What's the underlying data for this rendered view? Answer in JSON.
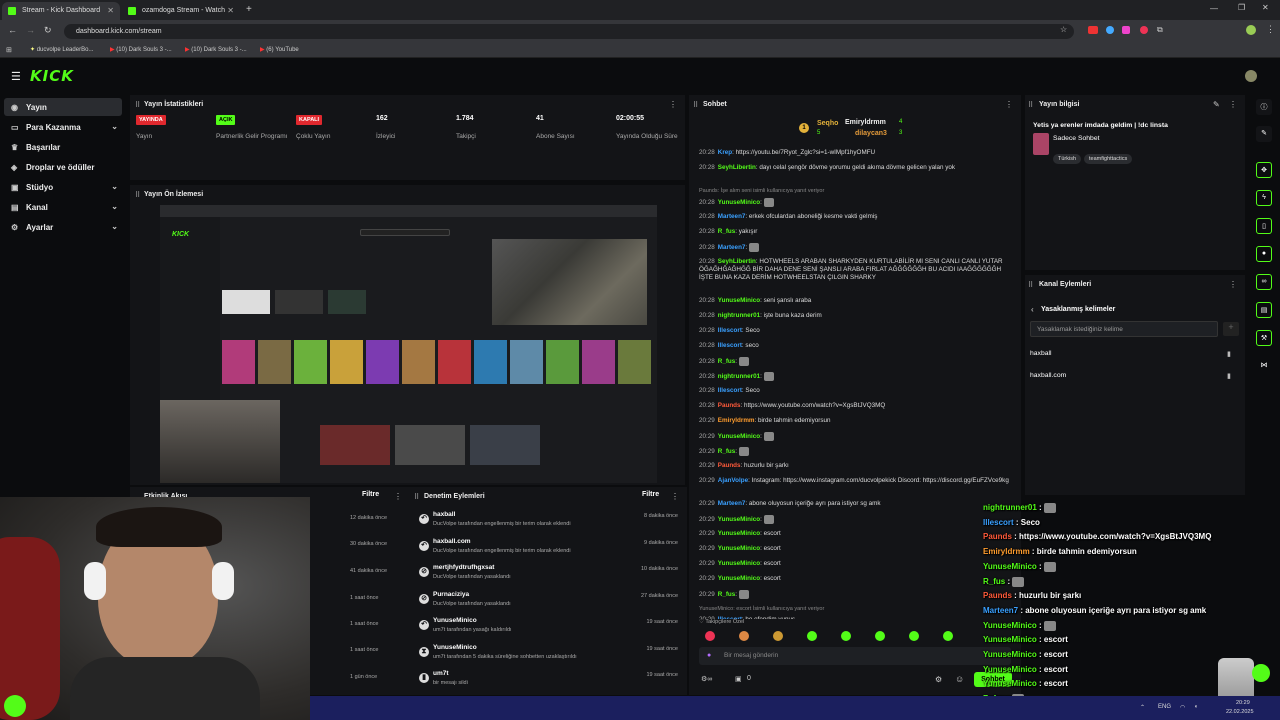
{
  "browser": {
    "tabs": [
      {
        "title": "Stream - Kick Dashboard",
        "active": true
      },
      {
        "title": "ozamdoga Stream - Watch",
        "active": false
      }
    ],
    "url": "dashboard.kick.com/stream",
    "bookmarks": [
      "ducvolpe LeaderBo...",
      "(10) Dark Souls 3 -...",
      "(10) Dark Souls 3 -...",
      "(6) YouTube"
    ]
  },
  "brand": {
    "logo": "KICK",
    "accent": "#53fc18"
  },
  "sidebar": {
    "items": [
      {
        "label": "Yayın",
        "active": true,
        "chevron": false,
        "icon": "broadcast-icon"
      },
      {
        "label": "Para Kazanma",
        "active": false,
        "chevron": true,
        "icon": "money-icon"
      },
      {
        "label": "Başarılar",
        "active": false,
        "chevron": false,
        "icon": "trophy-icon"
      },
      {
        "label": "Droplar ve ödüller",
        "active": false,
        "chevron": false,
        "icon": "gift-icon"
      },
      {
        "label": "Stüdyo",
        "active": false,
        "chevron": true,
        "icon": "studio-icon"
      },
      {
        "label": "Kanal",
        "active": false,
        "chevron": true,
        "icon": "channel-icon"
      },
      {
        "label": "Ayarlar",
        "active": false,
        "chevron": true,
        "icon": "gear-icon"
      }
    ]
  },
  "stats": {
    "title": "Yayın İstatistikleri",
    "items": [
      {
        "value": "YAYINDA",
        "label": "Yayın",
        "badge": "red"
      },
      {
        "value": "AÇIK",
        "label": "Partnerlik Gelir Programı",
        "badge": "green"
      },
      {
        "value": "KAPALI",
        "label": "Çoklu Yayın",
        "badge": "red"
      },
      {
        "value": "162",
        "label": "İzleyici"
      },
      {
        "value": "1.784",
        "label": "Takipçi"
      },
      {
        "value": "41",
        "label": "Abone Sayısı"
      },
      {
        "value": "02:00:55",
        "label": "Yayında Olduğu Süre"
      }
    ]
  },
  "preview": {
    "title": "Yayın Ön İzlemesi"
  },
  "activity": {
    "title": "Etkinlik Akışı",
    "filter": "Filtre",
    "times": [
      "12 dakika önce",
      "30 dakika önce",
      "41 dakika önce",
      "1 saat önce",
      "1 saat önce",
      "1 saat önce",
      "1 gün önce"
    ]
  },
  "moderation": {
    "title": "Denetim Eylemleri",
    "filter": "Filtre",
    "rows": [
      {
        "title": "haxball",
        "sub": "DucVolpe tarafından engellenmiş bir terim olarak eklendi",
        "time": "8 dakika önce",
        "icon": "undo-icon"
      },
      {
        "title": "haxball.com",
        "sub": "DucVolpe tarafından engellenmiş bir terim olarak eklendi",
        "time": "9 dakika önce",
        "icon": "undo-icon"
      },
      {
        "title": "mertjhfydtrufhgxsat",
        "sub": "DucVolpe tarafından yasaklandı",
        "time": "10 dakika önce",
        "icon": "ban-icon"
      },
      {
        "title": "Purnaciziya",
        "sub": "DucVolpe tarafından yasaklandı",
        "time": "27 dakika önce",
        "icon": "ban-icon"
      },
      {
        "title": "YunuseMinico",
        "sub": "um7t tarafından yasağı kaldırıldı",
        "time": "19 saat önce",
        "icon": "undo-icon"
      },
      {
        "title": "YunuseMinico",
        "sub": "um7t tarafından 5 dakika süreliğine sohbetten uzaklaştırıldı",
        "time": "19 saat önce",
        "icon": "hourglass-icon"
      },
      {
        "title": "um7t",
        "sub": "bir mesajı sildi",
        "time": "19 saat önce",
        "icon": "trash-icon"
      }
    ]
  },
  "chat": {
    "title": "Sohbet",
    "leaders": [
      {
        "name": "Seqho",
        "count": "5"
      },
      {
        "name": "Emiryldrmm",
        "count": "4"
      },
      {
        "name": "dilaycan3",
        "count": "3"
      }
    ],
    "messages": [
      {
        "time": "20:28",
        "user": "Krep",
        "color": "#3aa0ff",
        "text": "https://youtu.be/7Ryot_Zglc?si=1-wIMpf1hyOMFU"
      },
      {
        "time": "20:28",
        "user": "SeyhLibertin",
        "color": "#53fc18",
        "text": "dayı celal şengör dövme yorumu geldi akıma dövme gelicen yalan yok"
      },
      {
        "time": "",
        "user": "",
        "color": "#888",
        "text": "Paunds: İşe alım seni isimli kullanıcıya yanıt veriyor",
        "system": true
      },
      {
        "time": "20:28",
        "user": "YunuseMinico",
        "color": "#53fc18",
        "text": ""
      },
      {
        "time": "20:28",
        "user": "Marteen7",
        "color": "#3aa0ff",
        "text": "erkek ofculardan aboneliği kesme vakti gelmiş"
      },
      {
        "time": "20:28",
        "user": "R_fus",
        "color": "#53fc18",
        "text": "yakışır"
      },
      {
        "time": "20:28",
        "user": "Marteen7",
        "color": "#3aa0ff",
        "text": ""
      },
      {
        "time": "20:28",
        "user": "SeyhLibertin",
        "color": "#53fc18",
        "text": "HOTWHEELS ARABAN SHARKYDEN KURTULABİLİR MI SENI CANLI CANLI YUTAR ÖĞAĞHĞAĞHĞĞ BİR DAHA DENE SENİ ŞANSLI ARABA FIRLAT AĞĞĞĞĞĞH BU ACIDI IAAĞĞĞĞĞĞH İŞTE BUNA KAZA DERİM HOTWHEELSTAN ÇILGIN SHARKY"
      },
      {
        "time": "20:28",
        "user": "YunuseMinico",
        "color": "#53fc18",
        "text": "seni şanslı araba"
      },
      {
        "time": "20:28",
        "user": "nightrunner01",
        "color": "#53fc18",
        "text": "işte buna kaza derim"
      },
      {
        "time": "20:28",
        "user": "Illescort",
        "color": "#3aa0ff",
        "text": "Seco"
      },
      {
        "time": "20:28",
        "user": "Illescort",
        "color": "#3aa0ff",
        "text": "seco"
      },
      {
        "time": "20:28",
        "user": "R_fus",
        "color": "#53fc18",
        "text": ""
      },
      {
        "time": "20:28",
        "user": "nightrunner01",
        "color": "#53fc18",
        "text": ""
      },
      {
        "time": "20:28",
        "user": "Illescort",
        "color": "#3aa0ff",
        "text": "Seco"
      },
      {
        "time": "20:28",
        "user": "Paunds",
        "color": "#ff5a3a",
        "text": "https://www.youtube.com/watch?v=XgsBtJVQ3MQ"
      },
      {
        "time": "20:29",
        "user": "Emiryldrmm",
        "color": "#ff9d2e",
        "text": "birde tahmin edemiyorsun"
      },
      {
        "time": "20:29",
        "user": "YunuseMinico",
        "color": "#53fc18",
        "text": ""
      },
      {
        "time": "20:29",
        "user": "R_fus",
        "color": "#53fc18",
        "text": ""
      },
      {
        "time": "20:29",
        "user": "Paunds",
        "color": "#ff5a3a",
        "text": "huzurlu bir şarkı"
      },
      {
        "time": "20:29",
        "user": "AjanVolpe",
        "color": "#3aa0ff",
        "text": "Instagram: https://www.instagram.com/ducvolpekick Discord: https://discord.gg/EuFZVce9kg"
      },
      {
        "time": "20:29",
        "user": "Marteen7",
        "color": "#3aa0ff",
        "text": "abone oluyosun içeriğe ayrı para istiyor sg amk"
      },
      {
        "time": "20:29",
        "user": "YunuseMinico",
        "color": "#53fc18",
        "text": ""
      },
      {
        "time": "20:29",
        "user": "YunuseMinico",
        "color": "#53fc18",
        "text": "escort"
      },
      {
        "time": "20:29",
        "user": "YunuseMinico",
        "color": "#53fc18",
        "text": "escort"
      },
      {
        "time": "20:29",
        "user": "YunuseMinico",
        "color": "#53fc18",
        "text": "escort"
      },
      {
        "time": "20:29",
        "user": "YunuseMinico",
        "color": "#53fc18",
        "text": "escort"
      },
      {
        "time": "20:29",
        "user": "R_fus",
        "color": "#53fc18",
        "text": ""
      },
      {
        "time": "",
        "user": "",
        "color": "#888",
        "text": "YunuseMinico: escort İsimli kullanıcıya yanıt veriyor",
        "system": true
      },
      {
        "time": "20:29",
        "user": "Illescort",
        "color": "#3aa0ff",
        "text": "he efendim yunus"
      }
    ],
    "followers_only": "Takipçilere Özel",
    "input_placeholder": "Bir mesaj gönderin",
    "send_label": "Sohbet",
    "counts": {
      "viewers": "0",
      "gifts": "0"
    }
  },
  "stream_info": {
    "title": "Yayın bilgisi",
    "stream_title": "Yetis ya erenler imdada geldim | !dc linsta",
    "category": "Sadece Sohbet",
    "tags": [
      "Türkish",
      "teamfighttactics"
    ]
  },
  "channel_actions": {
    "title": "Kanal Eylemleri",
    "section": "Yasaklanmış kelimeler",
    "input_placeholder": "Yasaklamak istediğiniz kelime",
    "words": [
      "haxball",
      "haxball.com"
    ]
  },
  "overlay_chat": [
    {
      "user": "nightrunner01",
      "color": "#53fc18",
      "text": ""
    },
    {
      "user": "Illescort",
      "color": "#3aa0ff",
      "text": "Seco"
    },
    {
      "user": "Paunds",
      "color": "#ff5a3a",
      "text": "https://www.youtube.com/watch?v=XgsBtJVQ3MQ"
    },
    {
      "user": "Emiryldrmm",
      "color": "#ff9d2e",
      "text": "birde tahmin edemiyorsun"
    },
    {
      "user": "YunuseMinico",
      "color": "#53fc18",
      "text": ""
    },
    {
      "user": "R_fus",
      "color": "#53fc18",
      "text": ""
    },
    {
      "user": "Paunds",
      "color": "#ff5a3a",
      "text": "huzurlu bir şarkı"
    },
    {
      "user": "Marteen7",
      "color": "#3aa0ff",
      "text": "abone oluyosun içeriğe ayrı para istiyor sg amk"
    },
    {
      "user": "YunuseMinico",
      "color": "#53fc18",
      "text": ""
    },
    {
      "user": "YunuseMinico",
      "color": "#53fc18",
      "text": "escort"
    },
    {
      "user": "YunuseMinico",
      "color": "#53fc18",
      "text": "escort"
    },
    {
      "user": "YunuseMinico",
      "color": "#53fc18",
      "text": "escort"
    },
    {
      "user": "YunuseMinico",
      "color": "#53fc18",
      "text": "escort"
    },
    {
      "user": "R_fus",
      "color": "#53fc18",
      "text": ""
    },
    {
      "user": "Illescort",
      "color": "#3aa0ff",
      "text": "he efendim yunus"
    }
  ],
  "taskbar": {
    "lang": "ENG",
    "time": "20:29",
    "date": "22.02.2025"
  }
}
